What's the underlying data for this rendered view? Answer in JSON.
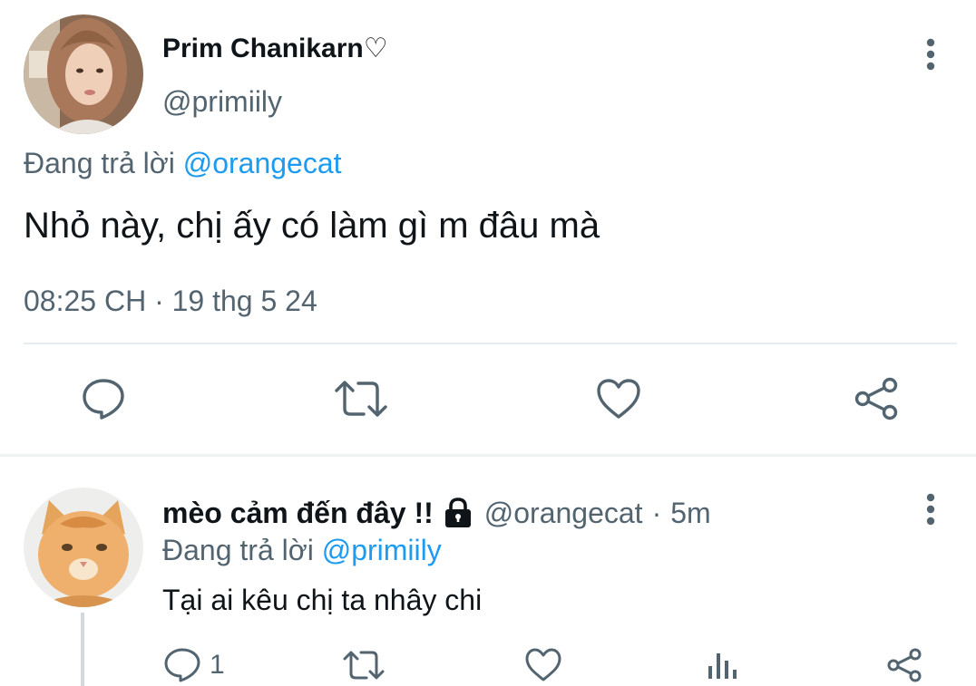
{
  "main_tweet": {
    "author_name": "Prim Chanikarn♡",
    "author_handle": "@primiily",
    "replying_to_label": "Đang trả lời",
    "replying_to_handle": "@orangecat",
    "text": "Nhỏ này, chị ấy có làm gì m đâu mà",
    "timestamp": "08:25 CH · 19 thg 5 24",
    "actions": [
      "reply-icon",
      "retweet-icon",
      "like-icon",
      "share-icon"
    ]
  },
  "reply_tweet": {
    "author_name": "mèo cảm đến đây !!",
    "protected_icon": "lock-icon",
    "author_handle": "@orangecat",
    "dot": "·",
    "age": "5m",
    "replying_to_label": "Đang trả lời",
    "replying_to_handle": "@primiily",
    "text": "Tại ai kêu chị ta nhây chi",
    "reply_count": "1",
    "actions": [
      "reply-icon",
      "retweet-icon",
      "like-icon",
      "views-icon",
      "share-icon"
    ]
  },
  "colors": {
    "text": "#0f1419",
    "secondary": "#536471",
    "link": "#1d9bf0",
    "divider": "#e6ecf0"
  }
}
